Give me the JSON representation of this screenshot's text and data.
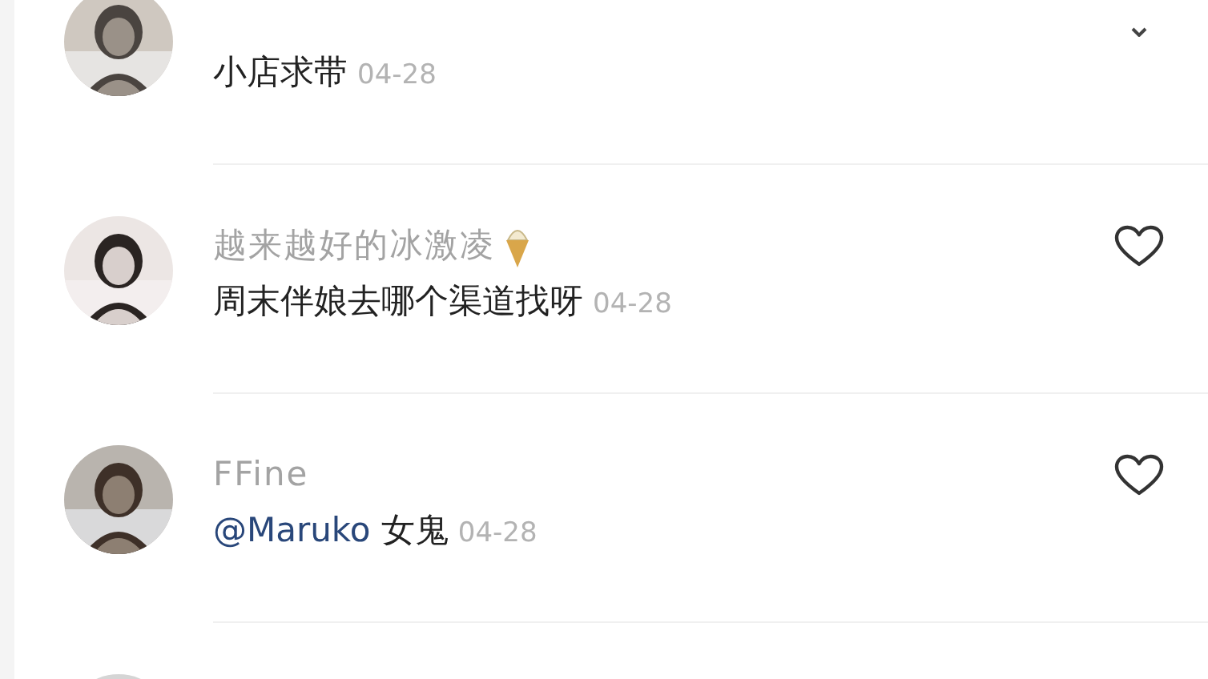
{
  "comments": [
    {
      "avatar": {
        "kind": "picture"
      },
      "action": {
        "kind": "caret"
      },
      "text": "小店求带",
      "date": "04-28"
    },
    {
      "avatar": {
        "kind": "picture"
      },
      "action": {
        "kind": "heart"
      },
      "name": "越来越好的冰激凌",
      "name_badge": {
        "kind": "icecream"
      },
      "text": "周末伴娘去哪个渠道找呀",
      "date": "04-28"
    },
    {
      "avatar": {
        "kind": "picture"
      },
      "action": {
        "kind": "heart"
      },
      "name": "FFine",
      "mention": "@Maruko",
      "text": "女鬼",
      "date": "04-28"
    },
    {
      "avatar": {
        "kind": "picture"
      }
    }
  ]
}
